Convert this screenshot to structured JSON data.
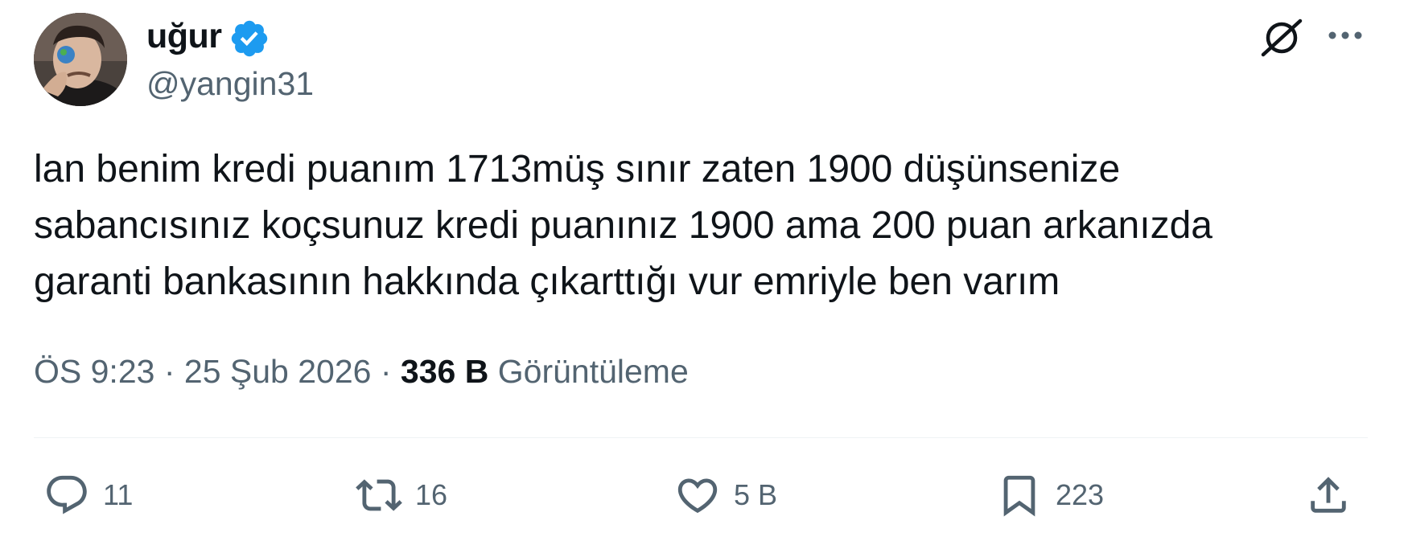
{
  "author": {
    "name": "uğur",
    "handle": "@yangin31",
    "verified": true,
    "verified_badge_color": "#1d9bf0"
  },
  "header_icons": {
    "grok": "grok-icon",
    "more": "more-icon"
  },
  "tweet": {
    "lines": [
      "lan benim kredi puanım 1713müş sınır zaten 1900 düşünsenize",
      "sabancısınız koçsunuz kredi puanınız 1900 ama 200 puan arkanızda",
      "garanti bankasının hakkında çıkarttığı vur emriyle ben varım"
    ]
  },
  "meta": {
    "time": "ÖS 9:23",
    "separator": "·",
    "date": "25 Şub 2026",
    "views_count": "336 B",
    "views_label": "Görüntüleme"
  },
  "actions": {
    "reply": {
      "icon": "reply-icon",
      "count": "11"
    },
    "retweet": {
      "icon": "retweet-icon",
      "count": "16"
    },
    "like": {
      "icon": "heart-icon",
      "count": "5 B"
    },
    "bookmark": {
      "icon": "bookmark-icon",
      "count": "223"
    },
    "share": {
      "icon": "share-icon"
    }
  },
  "colors": {
    "text_primary": "#0f1419",
    "text_secondary": "#536471",
    "divider": "#eff3f4"
  }
}
